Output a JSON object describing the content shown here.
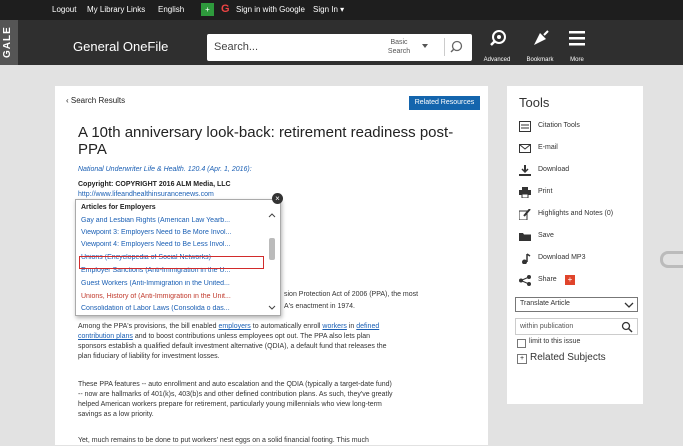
{
  "topbar": {
    "logout": "Logout",
    "my_library_links": "My Library Links",
    "language": "English",
    "google_box": "+",
    "google_logo": "G",
    "sign_in_google": "Sign in with Google",
    "sign_in": "Sign In ▾"
  },
  "header": {
    "brand": "GALE",
    "title": "General OneFile",
    "search_placeholder": "Search...",
    "basic_search": "Basic Search",
    "advanced": "Advanced",
    "bookmark": "Bookmark",
    "more": "More"
  },
  "article": {
    "back_label": "Search Results",
    "related_resources": "Related Resources",
    "title": "A 10th anniversary look-back: retirement readiness post-PPA",
    "citation": "National Underwriter Life & Health. 120.4 (Apr. 1, 2016):",
    "copyright": "Copyright: COPYRIGHT 2016 ALM Media, LLC",
    "url": "http://www.lifeandhealthinsurancenews.com",
    "partial_line1": "sion Protection Act of 2006 (PPA), the most",
    "partial_line2": "A's enactment in 1974.",
    "para1_a": "Among the PPA's provisions, the bill enabled ",
    "para1_link1": "employers",
    "para1_b": " to automatically enroll ",
    "para1_link2": "workers",
    "para1_c": " in ",
    "para1_link3": "defined",
    "para1_link4": "contribution plans",
    "para1_d": " and to boost contributions unless employees opt out. The PPA also lets plan",
    "para1_line3": "sponsors establish a qualified default investment alternative (QDIA), a default fund that releases the",
    "para1_line4": "plan fiduciary of liability for investment losses.",
    "para2_line1": "These PPA features -- auto enrollment and auto escalation and the QDIA (typically a target-date fund)",
    "para2_line2": "-- now are hallmarks of 401(k)s, 403(b)s and other defined contribution plans. As such, they've greatly",
    "para2_line3": "helped American workers prepare for retirement, particularly young millennials who view long-term",
    "para2_line4": "savings as a low priority.",
    "para3_line1": "Yet, much remains to be done to put workers' nest eggs on a solid financial footing. This much"
  },
  "dropdown": {
    "heading": "Articles for Employers",
    "close": "×",
    "items": [
      {
        "label": "Gay and Lesbian Rights (American Law Yearb...",
        "color": "#1a5fb4"
      },
      {
        "label": "Viewpoint 3: Employers Need to Be More Invol...",
        "color": "#1a5fb4"
      },
      {
        "label": "Viewpoint 4: Employers Need to Be Less Invol...",
        "color": "#1a5fb4"
      },
      {
        "label": "Unions (Encyclopedia of Social Networks)",
        "color": "#1a5fb4"
      },
      {
        "label": "Employer Sanctions (Anti-Immigration in the U...",
        "color": "#1a5fb4"
      },
      {
        "label": "Guest Workers (Anti-Immigration in the United...",
        "color": "#1a5fb4"
      },
      {
        "label": "Unions, History of (Anti-Immigration in the Unit...",
        "color": "#c0392b"
      },
      {
        "label": "Consolidation of Labor Laws (Consolida o das...",
        "color": "#1a5fb4"
      }
    ]
  },
  "tools": {
    "title": "Tools",
    "items": [
      {
        "label": "Citation Tools",
        "icon": "citation-icon"
      },
      {
        "label": "E-mail",
        "icon": "email-icon"
      },
      {
        "label": "Download",
        "icon": "download-icon"
      },
      {
        "label": "Print",
        "icon": "print-icon"
      },
      {
        "label": "Highlights and Notes (0)",
        "icon": "highlight-icon"
      },
      {
        "label": "Save",
        "icon": "folder-icon"
      },
      {
        "label": "Download MP3",
        "icon": "music-icon"
      },
      {
        "label": "Share",
        "icon": "share-icon"
      }
    ],
    "translate": "Translate Article",
    "within_placeholder": "within publication",
    "limit_label": "limit to this issue",
    "related_subjects": "Related Subjects",
    "plus": "+"
  }
}
